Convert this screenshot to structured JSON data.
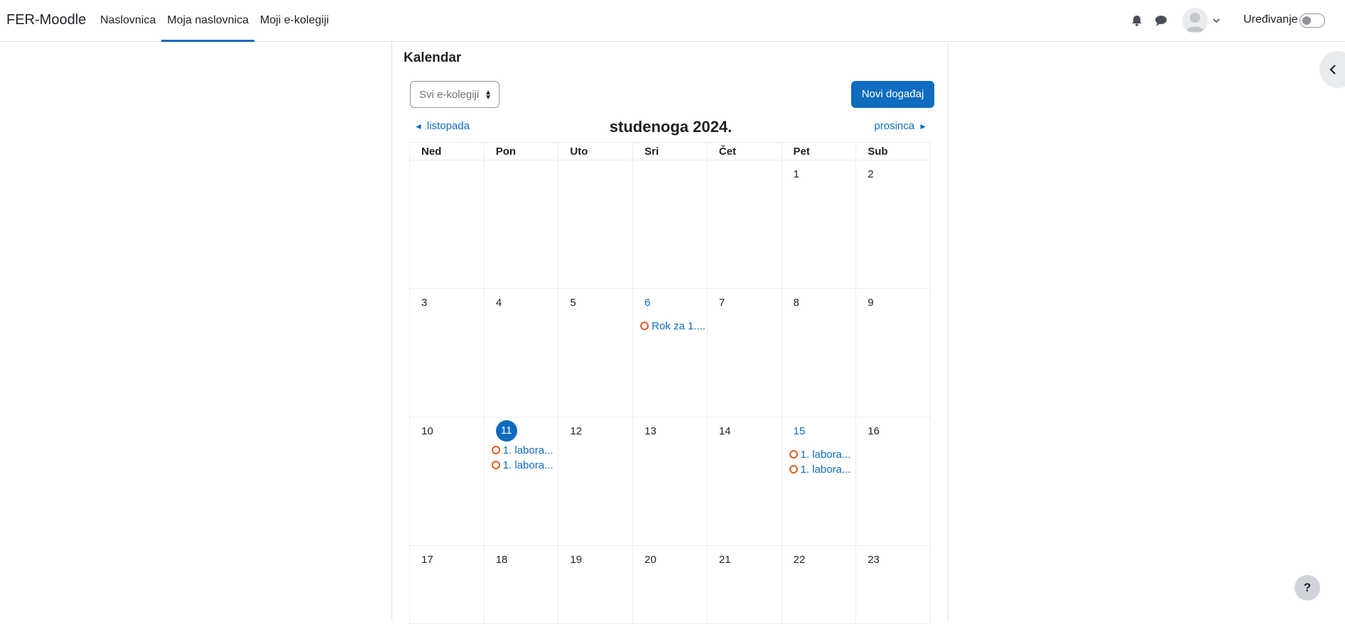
{
  "navbar": {
    "brand": "FER-Moodle",
    "items": [
      {
        "label": "Naslovnica",
        "active": false
      },
      {
        "label": "Moja naslovnica",
        "active": true
      },
      {
        "label": "Moji e-kolegiji",
        "active": false
      }
    ],
    "edit_label": "Uređivanje",
    "edit_mode": false
  },
  "calendar": {
    "heading": "Kalendar",
    "course_select": {
      "selected": "Svi e-kolegiji"
    },
    "new_event_label": "Novi događaj",
    "prev_month": "listopada",
    "next_month": "prosinca",
    "month_title": "studenoga 2024.",
    "weekdays": [
      "Ned",
      "Pon",
      "Uto",
      "Sri",
      "Čet",
      "Pet",
      "Sub"
    ],
    "weeks": [
      [
        {
          "day": ""
        },
        {
          "day": ""
        },
        {
          "day": ""
        },
        {
          "day": ""
        },
        {
          "day": ""
        },
        {
          "day": "1"
        },
        {
          "day": "2"
        }
      ],
      [
        {
          "day": "3"
        },
        {
          "day": "4"
        },
        {
          "day": "5"
        },
        {
          "day": "6",
          "events": [
            "Rok za 1...."
          ]
        },
        {
          "day": "7"
        },
        {
          "day": "8"
        },
        {
          "day": "9"
        }
      ],
      [
        {
          "day": "10"
        },
        {
          "day": "11",
          "today": true,
          "events": [
            "1. labora...",
            "1. labora..."
          ]
        },
        {
          "day": "12"
        },
        {
          "day": "13"
        },
        {
          "day": "14"
        },
        {
          "day": "15",
          "events": [
            "1. labora...",
            "1. labora..."
          ]
        },
        {
          "day": "16"
        }
      ],
      [
        {
          "day": "17"
        },
        {
          "day": "18"
        },
        {
          "day": "19"
        },
        {
          "day": "20"
        },
        {
          "day": "21"
        },
        {
          "day": "22"
        },
        {
          "day": "23"
        }
      ]
    ]
  },
  "help_label": "?",
  "colors": {
    "primary": "#0f6cbf",
    "event_dot": "#e05d22"
  },
  "icons": [
    "bell-icon",
    "chat-icon",
    "user-avatar-icon",
    "chevron-down-icon",
    "chevron-left-icon",
    "arrow-left-icon",
    "arrow-right-icon"
  ]
}
